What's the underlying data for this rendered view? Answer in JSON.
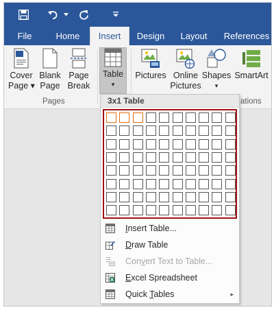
{
  "tabs": [
    {
      "label": "File"
    },
    {
      "label": "Home"
    },
    {
      "label": "Insert"
    },
    {
      "label": "Design"
    },
    {
      "label": "Layout"
    },
    {
      "label": "References"
    }
  ],
  "ribbon": {
    "pages_group_label": "Pages",
    "illustrations_group_label": "ations",
    "cover_page": {
      "line1": "Cover",
      "line2": "Page ▾"
    },
    "blank_page": {
      "line1": "Blank",
      "line2": "Page"
    },
    "page_break": {
      "line1": "Page",
      "line2": "Break"
    },
    "table": {
      "line1": "Table",
      "line2": "▾"
    },
    "pictures": {
      "line1": "Pictures"
    },
    "online_pictures": {
      "line1": "Online",
      "line2": "Pictures"
    },
    "shapes": {
      "line1": "Shapes",
      "line2": "▾"
    },
    "smartart": {
      "line1": "SmartArt"
    }
  },
  "dropdown": {
    "header": "3x1 Table",
    "grid": {
      "columns": 10,
      "rows": 8,
      "selected_columns": 3,
      "selected_rows": 1
    },
    "items": [
      {
        "pre": "",
        "u": "I",
        "post": "nsert Table...",
        "enabled": true
      },
      {
        "pre": "",
        "u": "D",
        "post": "raw Table",
        "enabled": true
      },
      {
        "pre": "Con",
        "u": "v",
        "post": "ert Text to Table...",
        "enabled": false
      },
      {
        "pre": "",
        "u": "E",
        "post": "xcel Spreadsheet",
        "enabled": true
      },
      {
        "pre": "Quick ",
        "u": "T",
        "post": "ables",
        "enabled": true,
        "submenu": "▸"
      }
    ]
  },
  "colors": {
    "titlebar": "#2b579a",
    "ribbon": "#f3f3f3",
    "grid_border": "#a01010",
    "selected_cell": "#e36c09"
  }
}
